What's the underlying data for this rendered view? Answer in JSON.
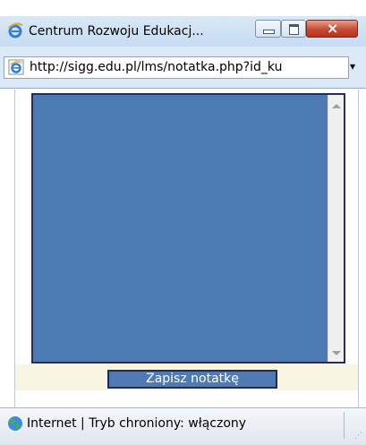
{
  "window": {
    "title": "Centrum Rozwoju Edukacj...",
    "buttons": {
      "minimize_icon": "minimize-icon",
      "maximize_icon": "maximize-icon",
      "close_glyph": "×"
    }
  },
  "address_bar": {
    "url": "http://sigg.edu.pl/lms/notatka.php?id_ku",
    "dropdown_glyph": "▾"
  },
  "note": {
    "textarea_value": "",
    "save_label": "Zapisz notatkę"
  },
  "status_bar": {
    "zone_text": "Internet | Tryb chroniony: włączony"
  },
  "colors": {
    "textarea_bg": "#4c7ab3",
    "button_bg": "#4f7ab4",
    "button_border": "#1e2b55",
    "strip_bg": "#f8f4e2"
  }
}
